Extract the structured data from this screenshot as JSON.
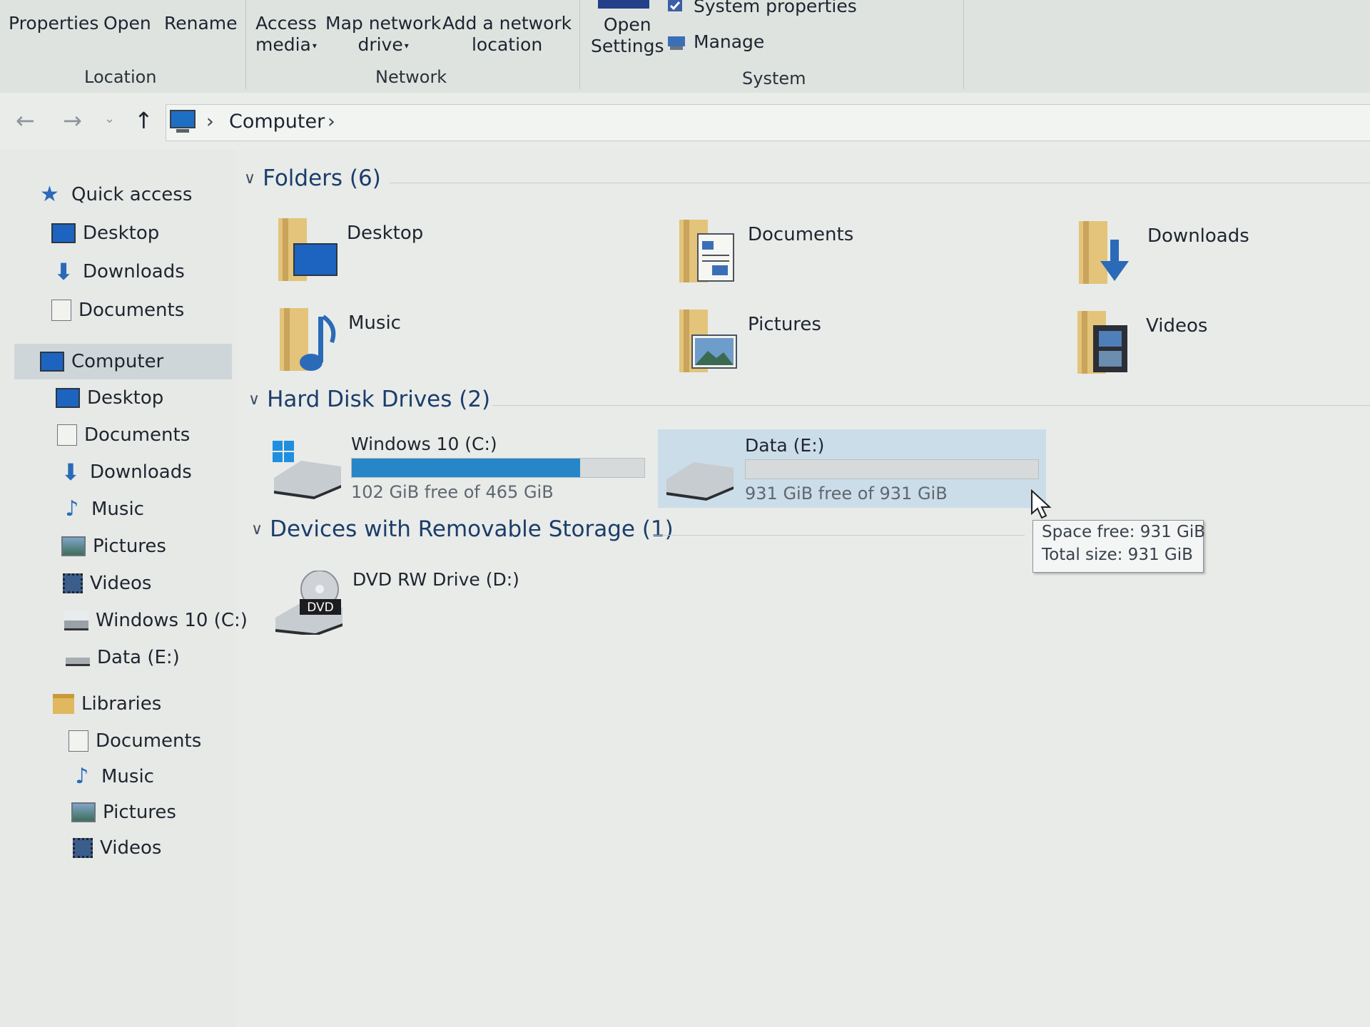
{
  "ribbon": {
    "location": {
      "properties": "Properties",
      "open": "Open",
      "rename": "Rename",
      "group": "Location"
    },
    "network": {
      "access_media_1": "Access",
      "access_media_2": "media",
      "map_drive_1": "Map network",
      "map_drive_2": "drive",
      "add_location_1": "Add a network",
      "add_location_2": "location",
      "group": "Network"
    },
    "system": {
      "open_settings_1": "Open",
      "open_settings_2": "Settings",
      "system_properties": "System properties",
      "manage": "Manage",
      "group": "System"
    }
  },
  "address": {
    "crumb": "Computer"
  },
  "sidebar": {
    "quick_access": "Quick access",
    "qa_items": [
      "Desktop",
      "Downloads",
      "Documents"
    ],
    "computer": "Computer",
    "computer_items": [
      "Desktop",
      "Documents",
      "Downloads",
      "Music",
      "Pictures",
      "Videos",
      "Windows 10 (C:)",
      "Data (E:)"
    ],
    "libraries": "Libraries",
    "library_items": [
      "Documents",
      "Music",
      "Pictures",
      "Videos"
    ]
  },
  "main": {
    "folders_header": "Folders (6)",
    "folders": [
      "Desktop",
      "Documents",
      "Downloads",
      "Music",
      "Pictures",
      "Videos"
    ],
    "hdd_header": "Hard Disk Drives (2)",
    "drives": [
      {
        "name": "Windows 10 (C:)",
        "free_text": "102 GiB free of 465 GiB",
        "used_fraction": 0.78
      },
      {
        "name": "Data (E:)",
        "free_text": "931 GiB free of 931 GiB",
        "used_fraction": 0.0
      }
    ],
    "removable_header": "Devices with Removable Storage (1)",
    "dvd": {
      "name": "DVD RW Drive (D:)",
      "badge": "DVD"
    }
  },
  "tooltip": {
    "line1": "Space free: 931 GiB",
    "line2": "Total size: 931 GiB"
  },
  "colors": {
    "accent": "#2686c8",
    "folder": "#e3c47a",
    "header_text": "#1b3d6b"
  }
}
